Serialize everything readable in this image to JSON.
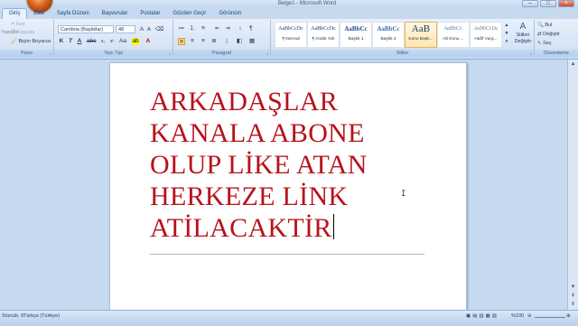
{
  "title_bar": {
    "document_title": "Belge1 - Microsoft Word"
  },
  "tabs": [
    "Giriş",
    "Ekle",
    "Sayfa Düzeni",
    "Başvurular",
    "Postalar",
    "Gözden Geçir",
    "Görünüm"
  ],
  "clipboard": {
    "cut_label": "Kes",
    "copy_label": "Kopyala",
    "format_painter_label": "Biçim Boyacısı",
    "paste_label": "Yapıştır",
    "group_label": "Pano"
  },
  "font": {
    "font_name": "Cambria (Başlıklar)",
    "font_size": "48",
    "group_label": "Yazı Tipi"
  },
  "paragraph": {
    "group_label": "Paragraf"
  },
  "styles": {
    "items": [
      {
        "sample": "AaBbCcDc",
        "name": "¶ Normal"
      },
      {
        "sample": "AaBbCcDc",
        "name": "¶ Aralık Yok"
      },
      {
        "sample": "AaBbCc",
        "name": "Başlık 1"
      },
      {
        "sample": "AaBbCc",
        "name": "Başlık 2"
      },
      {
        "sample": "AaB",
        "name": "Konu Başlı..."
      },
      {
        "sample": "AaBbCc.",
        "name": "Alt Konu ..."
      },
      {
        "sample": "AaBbCcDc",
        "name": "Hafif Vurg..."
      }
    ],
    "change_styles_label": "Stilleri Değiştir",
    "group_label": "Stiller"
  },
  "editing": {
    "find_label": "Bul",
    "replace_label": "Değiştir",
    "select_label": "Seç",
    "group_label": "Düzenleme"
  },
  "document": {
    "text": "ARKADAŞLAR\nKANALA ABONE\nOLUP LİKE ATAN\nHERKEZE LİNK\nATİLACAKTİR"
  },
  "status_bar": {
    "page_info": "Sözcük: 9",
    "language": "Türkçe (Türkiye)",
    "zoom": "%100"
  },
  "colors": {
    "text_red": "#b8121b",
    "ribbon": "#d6e4f5",
    "workspace": "#c6d9ee"
  }
}
